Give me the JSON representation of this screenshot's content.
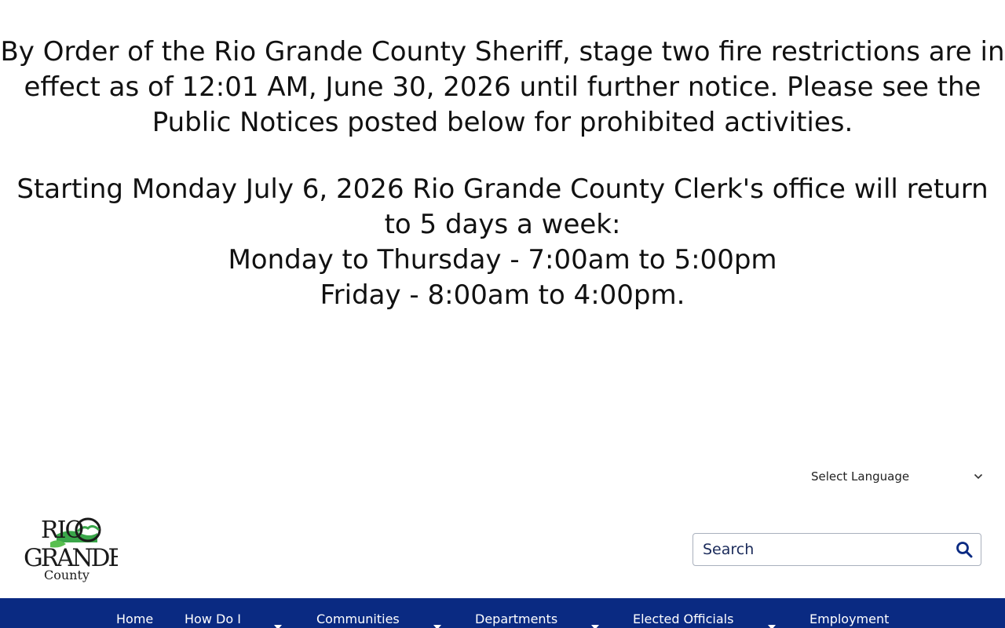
{
  "alert": {
    "paragraph1": "By Order of the Rio Grande County Sheriff, stage two fire restrictions are in effect as of 12:01 AM, June 30, 2026 until further notice. Please see the Public Notices posted below for prohibited activities.",
    "paragraph2_line1": "Starting Monday July 6, 2026 Rio Grande County Clerk's office will return to 5 days a week:",
    "paragraph2_line2": "Monday to Thursday - 7:00am to 5:00pm",
    "paragraph2_line3": "Friday - 8:00am to 4:00pm."
  },
  "language": {
    "label": "Select Language",
    "icon": "chevron-down-icon"
  },
  "logo": {
    "line1": "RIO",
    "line2": "GRANDE",
    "line3": "County"
  },
  "search": {
    "placeholder": "Search",
    "icon": "search-icon"
  },
  "nav": {
    "items": [
      {
        "label": "Home",
        "has_dropdown": false
      },
      {
        "label": "How Do I",
        "has_dropdown": true
      },
      {
        "label": "Communities",
        "has_dropdown": true
      },
      {
        "label": "Departments",
        "has_dropdown": true
      },
      {
        "label": "Elected Officials",
        "has_dropdown": true
      },
      {
        "label": "Employment",
        "has_dropdown": false
      }
    ]
  },
  "colors": {
    "nav_background": "#0a2a82",
    "search_text": "#1a2a5a",
    "logo_green": "#3aa64a"
  }
}
